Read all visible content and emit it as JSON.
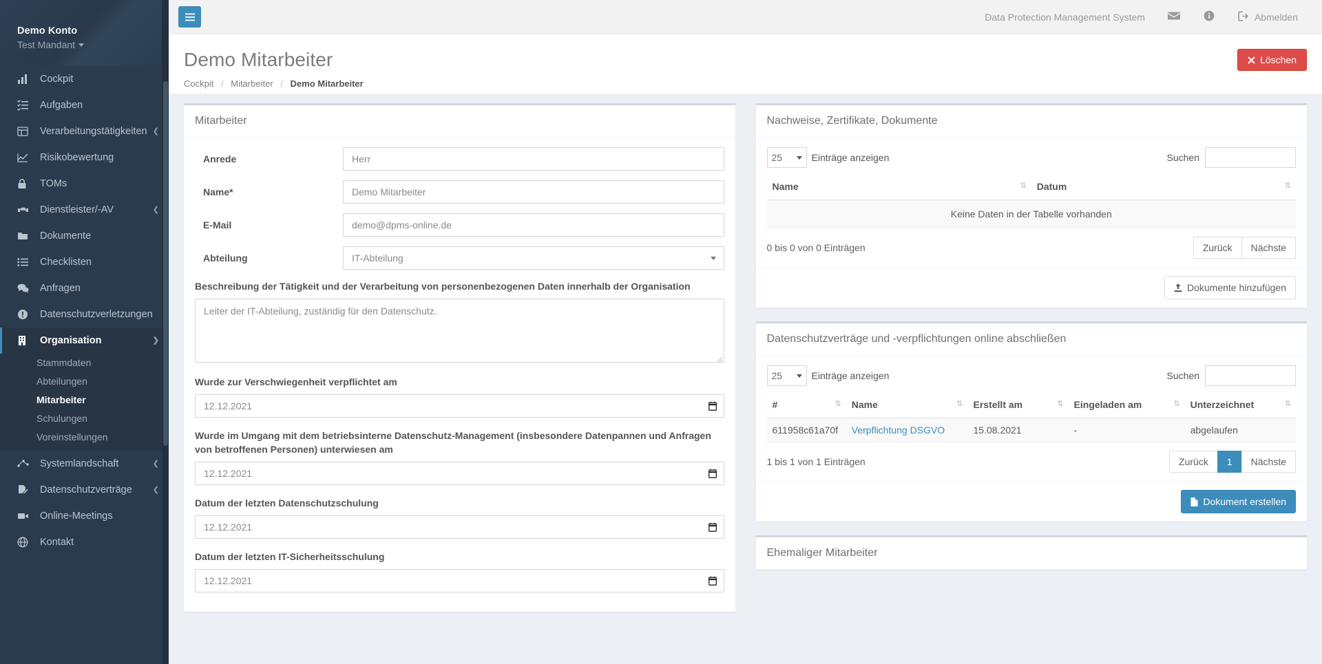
{
  "sidebar": {
    "account_name": "Demo Konto",
    "tenant_name": "Test Mandant",
    "items": [
      {
        "label": "Cockpit",
        "icon": "chart-bar-icon",
        "expandable": false
      },
      {
        "label": "Aufgaben",
        "icon": "tasks-icon",
        "expandable": false
      },
      {
        "label": "Verarbeitungstätigkeiten",
        "icon": "table-list-icon",
        "expandable": true
      },
      {
        "label": "Risikobewertung",
        "icon": "chart-line-icon",
        "expandable": false
      },
      {
        "label": "TOMs",
        "icon": "lock-icon",
        "expandable": false
      },
      {
        "label": "Dienstleister/-AV",
        "icon": "handshake-icon",
        "expandable": true
      },
      {
        "label": "Dokumente",
        "icon": "folder-icon",
        "expandable": false
      },
      {
        "label": "Checklisten",
        "icon": "list-icon",
        "expandable": false
      },
      {
        "label": "Anfragen",
        "icon": "comments-icon",
        "expandable": false
      },
      {
        "label": "Datenschutzverletzungen",
        "icon": "exclamation-circle-icon",
        "expandable": false
      }
    ],
    "organisation": {
      "label": "Organisation",
      "icon": "building-icon",
      "sub_items": [
        {
          "label": "Stammdaten",
          "active": false
        },
        {
          "label": "Abteilungen",
          "active": false
        },
        {
          "label": "Mitarbeiter",
          "active": true
        },
        {
          "label": "Schulungen",
          "active": false
        },
        {
          "label": "Voreinstellungen",
          "active": false
        }
      ]
    },
    "items_after": [
      {
        "label": "Systemlandschaft",
        "icon": "project-diagram-icon",
        "expandable": true
      },
      {
        "label": "Datenschutzverträge",
        "icon": "file-signature-icon",
        "expandable": true
      },
      {
        "label": "Online-Meetings",
        "icon": "video-icon",
        "expandable": false
      },
      {
        "label": "Kontakt",
        "icon": "globe-icon",
        "expandable": false
      }
    ]
  },
  "topbar": {
    "menu_toggle_label": "Menü",
    "system_name": "Data Protection Management System",
    "mail_label": "Nachrichten",
    "info_label": "Informationen",
    "logout_label": "Abmelden"
  },
  "page": {
    "title": "Demo Mitarbeiter",
    "delete_button": "Löschen",
    "breadcrumb": [
      {
        "label": "Cockpit",
        "current": false
      },
      {
        "label": "Mitarbeiter",
        "current": false
      },
      {
        "label": "Demo Mitarbeiter",
        "current": true
      }
    ]
  },
  "employee_box": {
    "title": "Mitarbeiter",
    "fields": [
      {
        "label": "Anrede",
        "value": "Herr",
        "type": "text"
      },
      {
        "label": "Name*",
        "value": "Demo Mitarbeiter",
        "type": "text"
      },
      {
        "label": "E-Mail",
        "value": "demo@dpms-online.de",
        "type": "text"
      },
      {
        "label": "Abteilung",
        "value": "IT-Abteilung",
        "type": "select"
      }
    ],
    "description_label": "Beschreibung der Tätigkeit und der Verarbeitung von personenbezogenen Daten innerhalb der Organisation",
    "description_value": "Leiter der IT-Abteilung, zuständig für den Datenschutz.",
    "date_fields": [
      {
        "label": "Wurde zur Verschwiegenheit verpflichtet am",
        "value": "12.12.2021"
      },
      {
        "label": "Wurde im Umgang mit dem betriebsinterne Datenschutz-Management (insbesondere Datenpannen und Anfragen von betroffenen Personen) unterwiesen am",
        "value": "12.12.2021"
      },
      {
        "label": "Datum der letzten Datenschutzschulung",
        "value": "12.12.2021"
      },
      {
        "label": "Datum der letzten IT-Sicherheitsschulung",
        "value": "12.12.2021"
      }
    ]
  },
  "documents_box": {
    "title": "Nachweise, Zertifikate, Dokumente",
    "length_value": "25",
    "length_label": "Einträge anzeigen",
    "search_label": "Suchen",
    "search_value": "",
    "columns": [
      "Name",
      "Datum"
    ],
    "empty_text": "Keine Daten in der Tabelle vorhanden",
    "info": "0 bis 0 von 0 Einträgen",
    "pager": {
      "prev": "Zurück",
      "next": "Nächste"
    },
    "footer_button": "Dokumente hinzufügen"
  },
  "contracts_box": {
    "title": "Datenschutzverträge und -verpflichtungen online abschließen",
    "length_value": "25",
    "length_label": "Einträge anzeigen",
    "search_label": "Suchen",
    "search_value": "",
    "columns": [
      "#",
      "Name",
      "Erstellt am",
      "Eingeladen am",
      "Unterzeichnet"
    ],
    "rows": [
      {
        "id": "611958c61a70f",
        "name": "Verpflichtung DSGVO",
        "created": "15.08.2021",
        "invited": "-",
        "signed": "abgelaufen"
      }
    ],
    "info": "1 bis 1 von 1 Einträgen",
    "pager": {
      "prev": "Zurück",
      "current": "1",
      "next": "Nächste"
    },
    "footer_button": "Dokument erstellen"
  },
  "former_box": {
    "title": "Ehemaliger Mitarbeiter"
  },
  "colors": {
    "sidebar_bg": "#2b3b4e",
    "accent": "#3c8dbc",
    "danger": "#dd4b4b",
    "content_bg": "#ecf0f5",
    "link": "#3c8dbc"
  }
}
